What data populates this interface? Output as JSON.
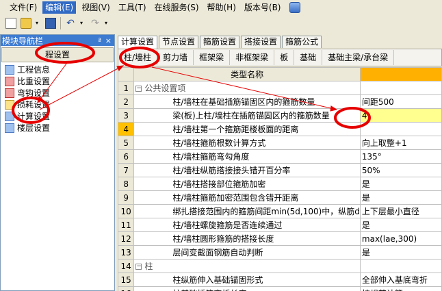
{
  "menu": [
    "文件(F)",
    "编辑(E)",
    "视图(V)",
    "工具(T)",
    "在线服务(S)",
    "帮助(H)",
    "版本号(B)"
  ],
  "nav": {
    "title": "模块导航栏",
    "pin": "ª",
    "close": "×",
    "group": "程设置",
    "items": [
      "工程信息",
      "比重设置",
      "弯钩设置",
      "损耗设置",
      "计算设置",
      "楼层设置"
    ]
  },
  "tabs": [
    "计算设置",
    "节点设置",
    "箍筋设置",
    "搭接设置",
    "箍筋公式"
  ],
  "subtabs": [
    "柱/墙柱",
    "剪力墙",
    "框架梁",
    "非框架梁",
    "板",
    "基础",
    "基础主梁/承台梁"
  ],
  "grid": {
    "header": "类型名称",
    "rows": [
      {
        "num": "1",
        "name": "公共设置项",
        "value": "",
        "group": true
      },
      {
        "num": "2",
        "name": "柱/墙柱在基础插筋锚固区内的箍筋数量",
        "value": "间距500"
      },
      {
        "num": "3",
        "name": "梁(板)上柱/墙柱在插筋锚固区内的箍筋数量",
        "value": "4"
      },
      {
        "num": "4",
        "name": "柱/墙柱第一个箍筋距楼板面的距离",
        "value": ""
      },
      {
        "num": "5",
        "name": "柱/墙柱箍筋根数计算方式",
        "value": "向上取整+1"
      },
      {
        "num": "6",
        "name": "柱/墙柱箍筋弯勾角度",
        "value": "135°"
      },
      {
        "num": "7",
        "name": "柱/墙柱纵筋搭接接头错开百分率",
        "value": "50%"
      },
      {
        "num": "8",
        "name": "柱/墙柱搭接部位箍筋加密",
        "value": "是"
      },
      {
        "num": "9",
        "name": "柱/墙柱箍筋加密范围包含错开距离",
        "value": "是"
      },
      {
        "num": "10",
        "name": "绑扎搭接范围内的箍筋间距min(5d,100)中，纵筋d",
        "value": "上下层最小直径"
      },
      {
        "num": "11",
        "name": "柱/墙柱螺旋箍筋是否连续通过",
        "value": "是"
      },
      {
        "num": "12",
        "name": "柱/墙柱圆形箍筋的搭接长度",
        "value": "max(lae,300)"
      },
      {
        "num": "13",
        "name": "层间变截面钢筋自动判断",
        "value": "是"
      },
      {
        "num": "14",
        "name": "柱",
        "value": "",
        "group": true
      },
      {
        "num": "15",
        "name": "柱纵筋伸入基础锚固形式",
        "value": "全部伸入基底弯折"
      },
      {
        "num": "16",
        "name": "柱基础插筋弯折长度",
        "value": "按规范计算"
      }
    ]
  },
  "colors": {
    "accent": "#316ac5",
    "annotation": "#e60000",
    "highlight": "#ffc000"
  }
}
